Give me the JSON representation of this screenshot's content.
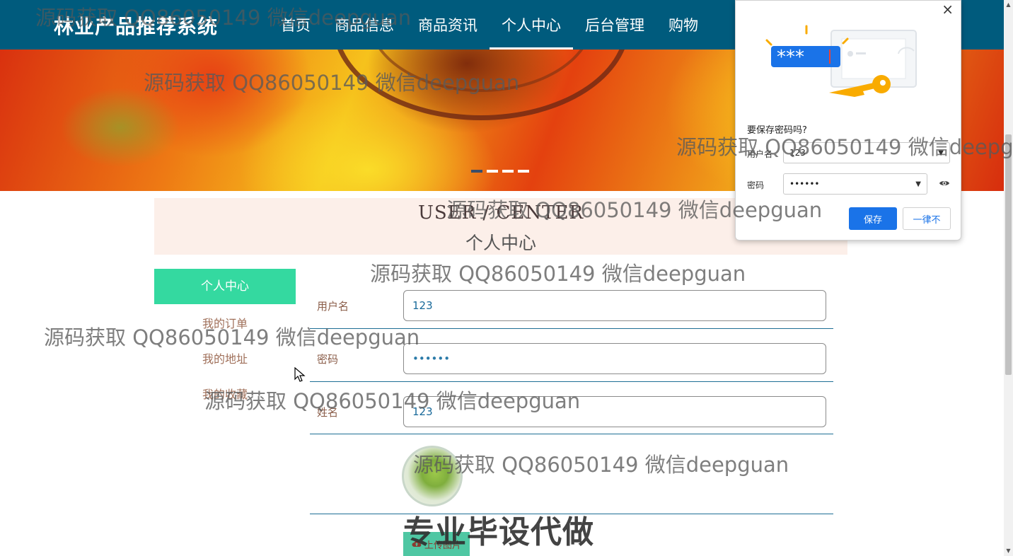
{
  "header": {
    "site_title": "林业产品推荐系统",
    "nav": [
      "首页",
      "商品信息",
      "商品资讯",
      "个人中心",
      "后台管理",
      "购物"
    ],
    "active_nav": "个人中心",
    "bg_color": "#005b7d"
  },
  "banner": {
    "slide_count": 4,
    "active_index": 0
  },
  "section": {
    "title_en": "USER / CENTER",
    "title_cn": "个人中心"
  },
  "sidebar": {
    "active": "个人中心",
    "links": [
      "我的订单",
      "我的地址",
      "我的收藏"
    ],
    "accent_color": "#34d9a0"
  },
  "form": {
    "username_label": "用户名",
    "username_value": "123",
    "password_label": "密码",
    "password_value": "••••••",
    "name_label": "姓名",
    "name_value": "123",
    "upload_label": "上传图片",
    "upload_icon": "upload-cloud-icon"
  },
  "promo_text": "专业毕设代做",
  "password_popup": {
    "close": "×",
    "title": "要保存密码吗?",
    "username_label": "用户名",
    "username_value": "123",
    "password_label": "密码",
    "password_value": "••••••",
    "save_label": "保存",
    "never_label": "一律不",
    "illustration_text": "***",
    "save_color": "#1a73e8"
  },
  "watermarks": [
    "源码获取 QQ86050149 微信deepguan",
    "源码获取 QQ86050149 微信deepguan",
    "源码获取 QQ86050149 微信deepg",
    "源码获取 QQ86050149 微信deepguan",
    "源码获取 QQ86050149 微信deepguan",
    "源码获取 QQ86050149 微信deepguan",
    "源码获取 QQ86050149 微信deepguan",
    "源码获取 QQ86050149 微信deepguan"
  ]
}
